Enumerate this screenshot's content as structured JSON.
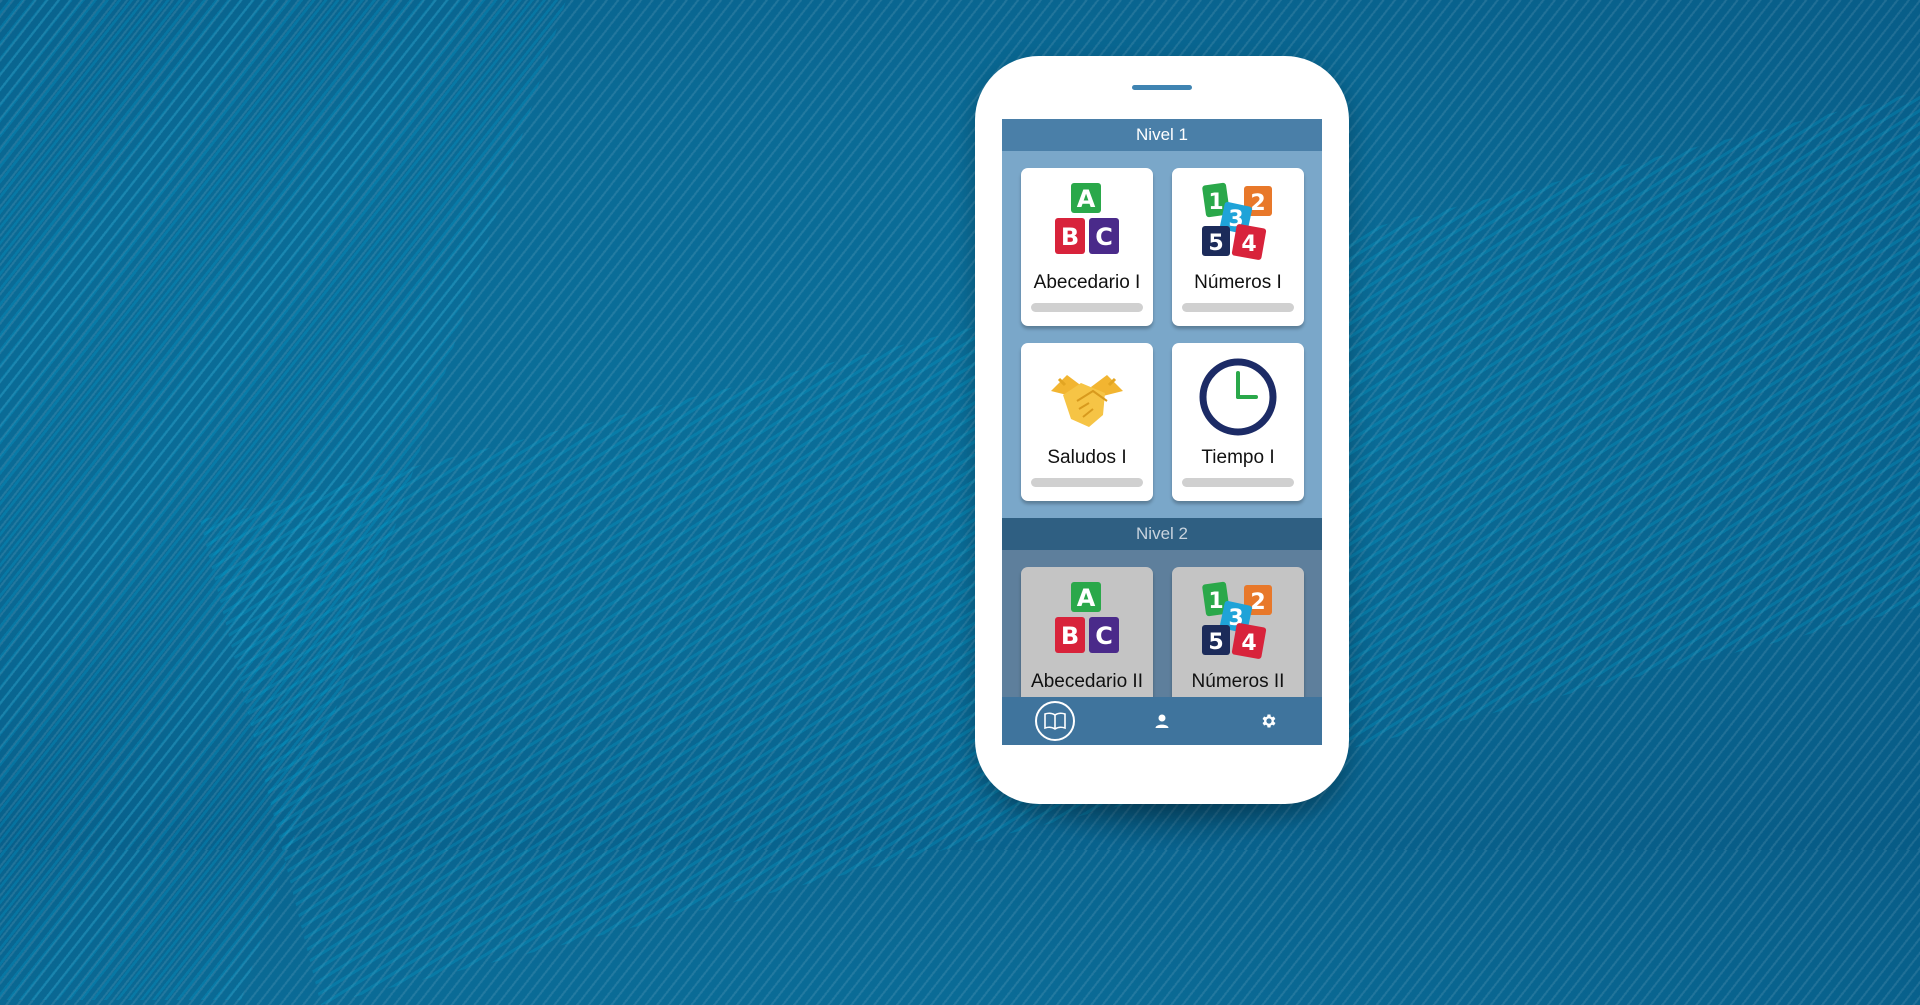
{
  "screen": {
    "levels": [
      {
        "title": "Nivel 1",
        "cards": [
          {
            "label": "Abecedario I",
            "icon": "abc-blocks-icon",
            "progress": 0
          },
          {
            "label": "Números I",
            "icon": "number-blocks-icon",
            "progress": 0
          },
          {
            "label": "Saludos I",
            "icon": "handshake-icon",
            "progress": 0
          },
          {
            "label": "Tiempo I",
            "icon": "clock-icon",
            "progress": 0
          }
        ]
      },
      {
        "title": "Nivel 2",
        "cards": [
          {
            "label": "Abecedario II",
            "icon": "abc-blocks-icon",
            "locked": true
          },
          {
            "label": "Números II",
            "icon": "number-blocks-icon",
            "locked": true
          }
        ]
      }
    ],
    "bottom_nav": [
      {
        "icon": "book-icon",
        "active": true
      },
      {
        "icon": "user-icon",
        "active": false
      },
      {
        "icon": "gear-icon",
        "active": false
      }
    ]
  },
  "colors": {
    "header": "#4a7fa8",
    "level1_bg": "#7aa7c9",
    "level2_bg": "#5e7f9c",
    "nav_bg": "#3f749d"
  }
}
